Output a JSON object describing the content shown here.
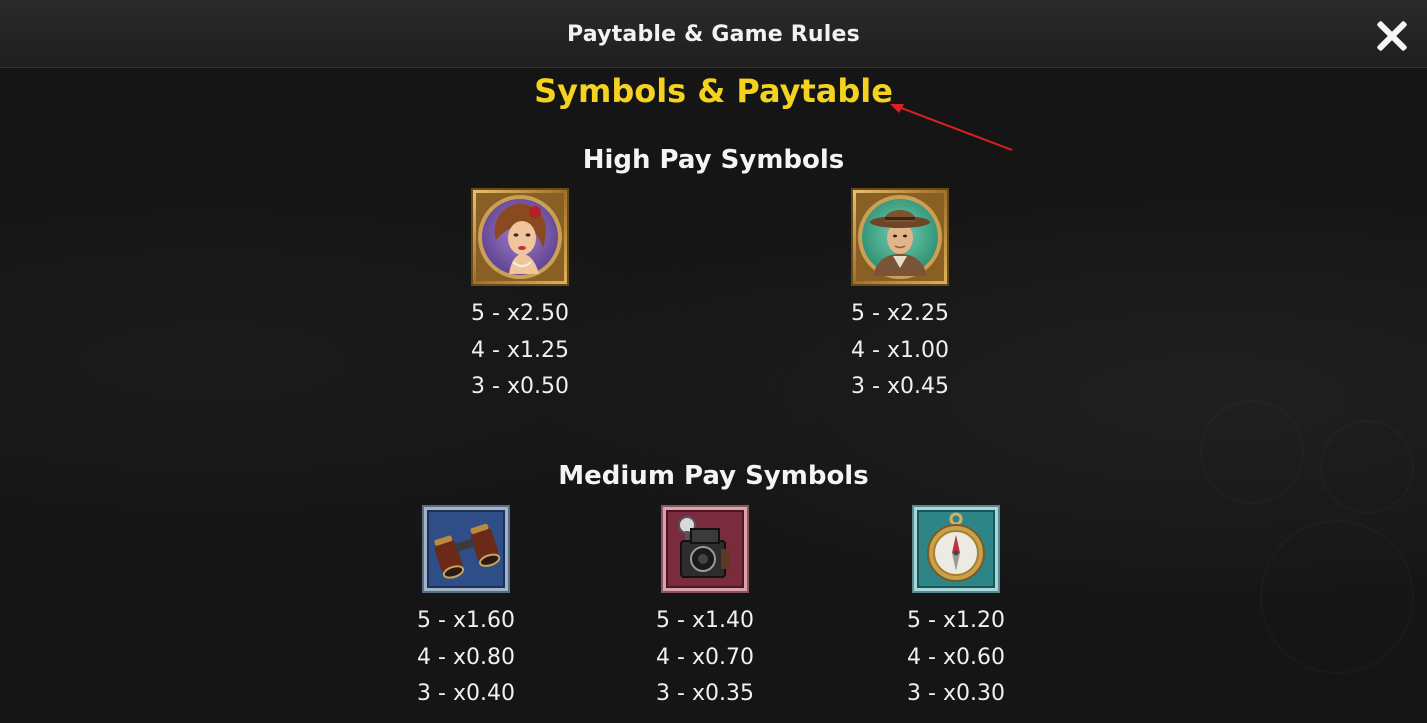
{
  "header": {
    "title": "Paytable & Game Rules",
    "close_icon": "close-icon"
  },
  "content": {
    "section_title": "Symbols & Paytable",
    "high_pay": {
      "title": "High Pay Symbols",
      "symbols": [
        {
          "name": "woman-portrait-symbol",
          "pays": [
            "5 - x2.50",
            "4 - x1.25",
            "3 - x0.50"
          ]
        },
        {
          "name": "explorer-portrait-symbol",
          "pays": [
            "5 - x2.25",
            "4 - x1.00",
            "3 - x0.45"
          ]
        }
      ]
    },
    "medium_pay": {
      "title": "Medium Pay Symbols",
      "symbols": [
        {
          "name": "binoculars-symbol",
          "pays": [
            "5 - x1.60",
            "4 - x0.80",
            "3 - x0.40"
          ]
        },
        {
          "name": "camera-symbol",
          "pays": [
            "5 - x1.40",
            "4 - x0.70",
            "3 - x0.35"
          ]
        },
        {
          "name": "compass-symbol",
          "pays": [
            "5 - x1.20",
            "4 - x0.60",
            "3 - x0.30"
          ]
        }
      ]
    }
  },
  "colors": {
    "accent_yellow": "#f4d21f",
    "annotation_red": "#e02020",
    "text_white": "#f0f0f0"
  }
}
